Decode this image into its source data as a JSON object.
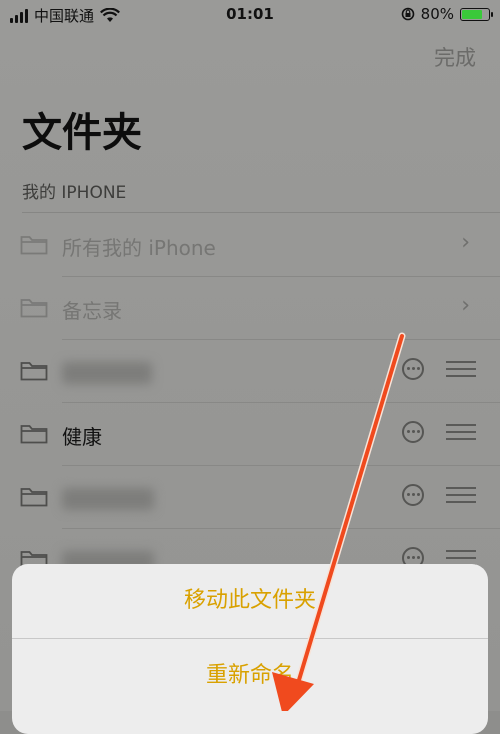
{
  "status_bar": {
    "carrier": "中国联通",
    "time": "01:01",
    "battery_text": "80%",
    "battery_level": 0.8,
    "battery_color": "#3ac93a"
  },
  "header": {
    "done_label": "完成",
    "title": "文件夹"
  },
  "section": {
    "header": "我的 IPHONE"
  },
  "folders": [
    {
      "label": "所有我的 iPhone",
      "accessory": "chevron",
      "dimmed": true
    },
    {
      "label": "备忘录",
      "accessory": "chevron",
      "dimmed": true
    },
    {
      "label": "",
      "accessory": "more+handle",
      "blurred": true
    },
    {
      "label": "健康",
      "accessory": "more+handle"
    },
    {
      "label": "",
      "accessory": "more+handle",
      "blurred": true
    },
    {
      "label": "",
      "accessory": "more+handle",
      "blurred": true
    }
  ],
  "action_sheet": {
    "items": [
      "移动此文件夹",
      "重新命名"
    ],
    "accent_color": "#d9a100"
  },
  "annotation": {
    "arrow_color": "#f04a1e"
  }
}
